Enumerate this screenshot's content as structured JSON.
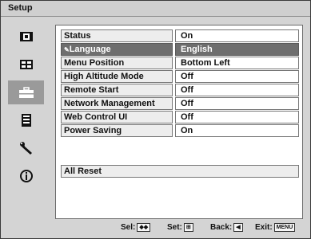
{
  "title": "Setup",
  "sidebar": {
    "icons": [
      {
        "name": "picture-icon"
      },
      {
        "name": "screen-icon"
      },
      {
        "name": "setup-toolbox-icon",
        "selected": true
      },
      {
        "name": "menu-icon"
      },
      {
        "name": "wrench-icon"
      },
      {
        "name": "info-icon"
      }
    ]
  },
  "rows": [
    {
      "label": "Status",
      "value": "On"
    },
    {
      "label": "Language",
      "value": "English",
      "selected": true,
      "icon": "language-icon"
    },
    {
      "label": "Menu Position",
      "value": "Bottom Left"
    },
    {
      "label": "High Altitude Mode",
      "value": "Off"
    },
    {
      "label": "Remote Start",
      "value": "Off"
    },
    {
      "label": "Network Management",
      "value": "Off"
    },
    {
      "label": "Web Control UI",
      "value": "Off"
    },
    {
      "label": "Power Saving",
      "value": "On"
    }
  ],
  "reset": "All Reset",
  "footer": {
    "sel": "Sel:",
    "sel_key": "◆◆",
    "set": "Set:",
    "set_key": "⊞",
    "back": "Back:",
    "back_key": "◀",
    "exit": "Exit:",
    "exit_key": "MENU"
  },
  "colors": {
    "selected_row": "#6e6e6e",
    "selected_icon": "#9a9a9a"
  }
}
